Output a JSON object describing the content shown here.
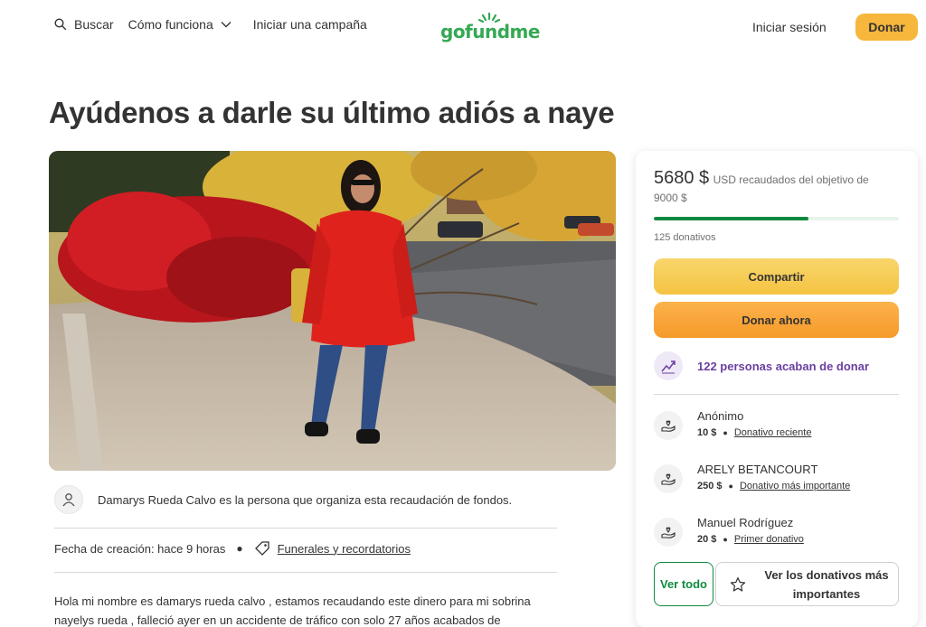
{
  "header": {
    "search_label": "Buscar",
    "how_it_works_label": "Cómo funciona",
    "start_campaign_label": "Iniciar una campaña",
    "logo_text": "gofundme",
    "login_label": "Iniciar sesión",
    "donate_label": "Donar"
  },
  "campaign": {
    "title": "Ayúdenos a darle su último adiós a naye",
    "organizer_text": "Damarys Rueda Calvo es la persona que organiza esta recaudación de fondos.",
    "created_label": "Fecha de creación: hace 9 horas",
    "category_label": "Funerales y recordatorios",
    "story_line1": "Hola mi nombre es damarys rueda calvo , estamos recaudando este dinero para mi sobrina",
    "story_line2": "nayelys rueda , falleció ayer en un accidente de tráfico con solo 27 años acabados de"
  },
  "donation_card": {
    "raised_amount": "5680 $",
    "raised_label": "USD recaudados del objetivo de 9000 $",
    "progress_fraction": 0.63,
    "donations_count": "125 donativos",
    "share_label": "Compartir",
    "donate_now_label": "Donar ahora",
    "recent_donors_text": "122 personas acaban de donar",
    "donors": [
      {
        "name": "Anónimo",
        "amount": "10 $",
        "tag": "Donativo reciente"
      },
      {
        "name": "ARELY BETANCOURT",
        "amount": "250 $",
        "tag": "Donativo más importante"
      },
      {
        "name": "Manuel Rodríguez",
        "amount": "20 $",
        "tag": "Primer donativo"
      }
    ],
    "see_all_label": "Ver todo",
    "see_top_label": "Ver los donativos más importantes"
  },
  "colors": {
    "brand_green": "#35a853",
    "progress_green": "#0f8a3f",
    "donate_yellow": "#f6b73c",
    "share_yellow": "#f5c342",
    "donate_orange": "#f69a2a",
    "recent_purple": "#6b3fa0"
  },
  "icons": {
    "search": "search-icon",
    "chevron": "chevron-down-icon",
    "tag": "tag-icon",
    "avatar": "user-icon",
    "trend": "trending-up-icon",
    "donor": "heart-hand-icon",
    "star": "star-icon"
  }
}
